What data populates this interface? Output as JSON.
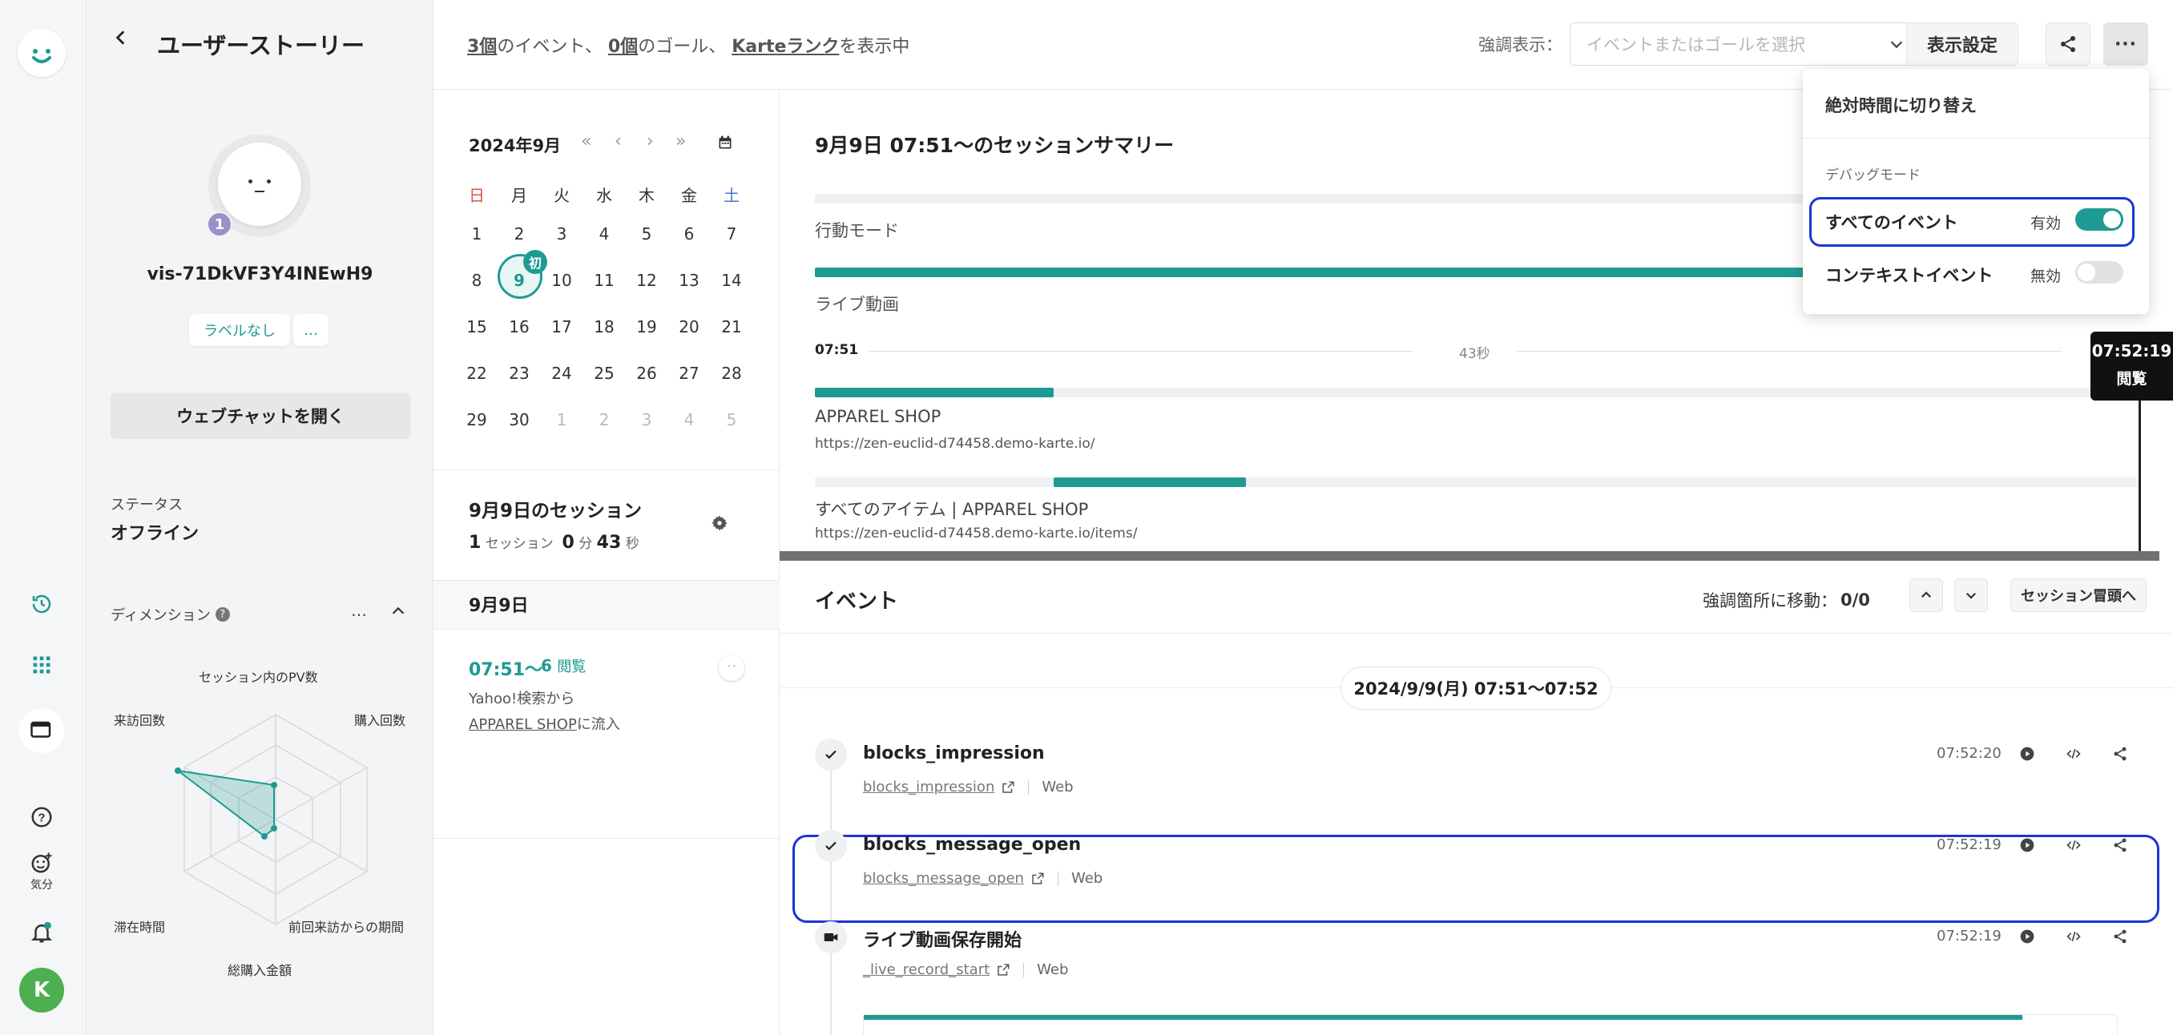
{
  "rail": {
    "logo": "karte-face-icon",
    "icons": [
      "history-icon",
      "grid-icon",
      "window-icon",
      "help-icon",
      "mood-icon",
      "bell-icon"
    ],
    "mood_label": "気分",
    "avatar_letter": "K",
    "colors": {
      "accent": "#1f9a93",
      "avatar": "#4caf50",
      "badge": "#1f9a93"
    }
  },
  "profile": {
    "header_title": "ユーザーストーリー",
    "badge_count": "1",
    "visitor_id": "vis-71DkVF3Y4INEwH9",
    "label_chip": "ラベルなし",
    "more_chip": "…",
    "open_chat": "ウェブチャットを開く",
    "status_label": "ステータス",
    "status_value": "オフライン",
    "dimension_label": "ディメンション",
    "dimension_more": "…",
    "radar_labels": {
      "top": "セッション内のPV数",
      "top_right": "購入回数",
      "bottom_right": "前回来訪からの期間",
      "bottom": "総購入金額",
      "bottom_left": "滞在時間",
      "top_left": "来訪回数"
    }
  },
  "topbar": {
    "events_count": "3個",
    "events_text": "のイベント、",
    "goals_count": "0個",
    "goals_text": "のゴール、",
    "rank_link": "Karteランク",
    "rank_text": "を表示中",
    "highlight_label": "強調表示：",
    "highlight_placeholder": "イベントまたはゴールを選択",
    "display_settings": "表示設定"
  },
  "calendar": {
    "month": "2024年9月",
    "nav": [
      "«",
      "‹",
      "›",
      "»"
    ],
    "weekdays": [
      "日",
      "月",
      "火",
      "水",
      "木",
      "金",
      "土"
    ],
    "weeks": [
      [
        "1",
        "2",
        "3",
        "4",
        "5",
        "6",
        "7"
      ],
      [
        "8",
        "9",
        "10",
        "11",
        "12",
        "13",
        "14"
      ],
      [
        "15",
        "16",
        "17",
        "18",
        "19",
        "20",
        "21"
      ],
      [
        "22",
        "23",
        "24",
        "25",
        "26",
        "27",
        "28"
      ],
      [
        "29",
        "30",
        "1",
        "2",
        "3",
        "4",
        "5"
      ]
    ],
    "selected_day": "9",
    "first_badge": "初",
    "session_title": "9月9日のセッション",
    "session_count": "1",
    "session_unit": "セッション",
    "minutes": "0",
    "minutes_unit": "分",
    "seconds": "43",
    "seconds_unit": "秒",
    "day_header": "9月9日",
    "entry_time": "07:51〜",
    "entry_views": "6",
    "entry_views_unit": "閲覧",
    "entry_source": "Yahoo!検索から",
    "entry_link": "APPAREL SHOP",
    "entry_suffix": "に流入"
  },
  "summary": {
    "title": "9月9日 07:51〜のセッションサマリー",
    "behavior_mode": "行動モード",
    "live_video": "ライブ動画",
    "start_time": "07:51",
    "duration": "43秒",
    "page1_title": "APPAREL SHOP",
    "page1_url": "https://zen-euclid-d74458.demo-karte.io/",
    "page2_title": "すべてのアイテム | APPAREL SHOP",
    "page2_url": "https://zen-euclid-d74458.demo-karte.io/items/",
    "tooltip_time": "07:52:19",
    "tooltip_label": "閲覧"
  },
  "events": {
    "title": "イベント",
    "jump_label": "強調箇所に移動：",
    "jump_value": "0/0",
    "session_start_btn": "セッション冒頭へ",
    "date_range": "2024/9/9(月) 07:51〜07:52",
    "list": [
      {
        "name": "blocks_impression",
        "link": "blocks_impression",
        "source": "Web",
        "time": "07:52:20",
        "icon": "check-icon"
      },
      {
        "name": "blocks_message_open",
        "link": "blocks_message_open",
        "source": "Web",
        "time": "07:52:19",
        "icon": "check-icon"
      },
      {
        "name": "ライブ動画保存開始",
        "link": "_live_record_start",
        "source": "Web",
        "time": "07:52:19",
        "icon": "video-icon"
      }
    ]
  },
  "menu": {
    "absolute_time": "絶対時間に切り替え",
    "debug_mode": "デバッグモード",
    "all_events": "すべてのイベント",
    "all_events_state": "有効",
    "context_events": "コンテキストイベント",
    "context_events_state": "無効"
  }
}
